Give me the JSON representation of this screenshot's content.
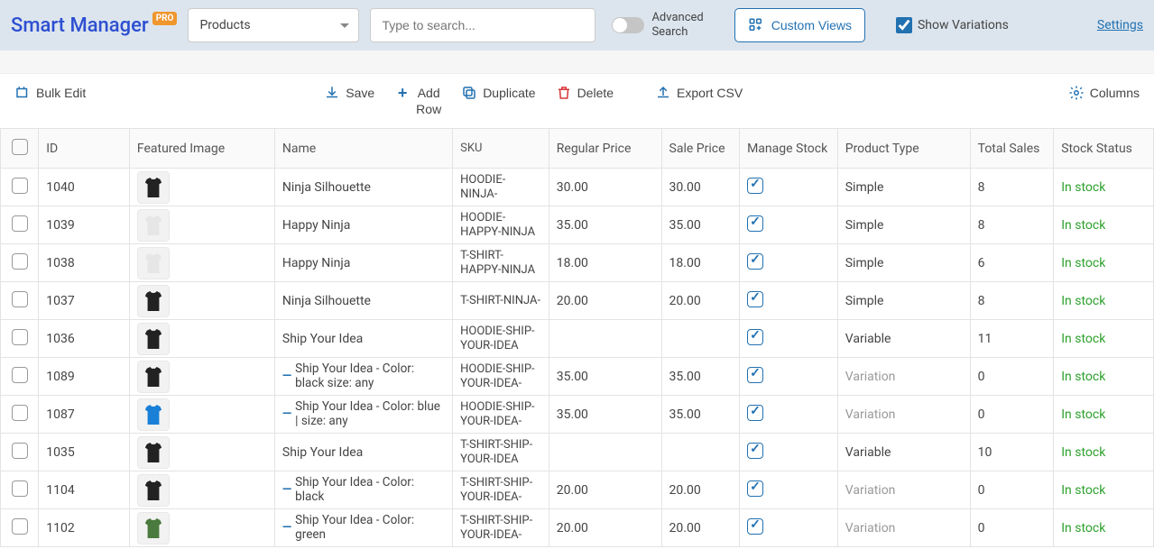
{
  "brand": {
    "name": "Smart Manager",
    "badge": "PRO"
  },
  "header": {
    "dashboard_selected": "Products",
    "search_placeholder": "Type to search...",
    "advanced_search": "Advanced\nSearch",
    "custom_views": "Custom Views",
    "show_variations": "Show Variations",
    "settings": "Settings"
  },
  "actions": {
    "bulk_edit": "Bulk Edit",
    "save": "Save",
    "add_row": "Add Row",
    "duplicate": "Duplicate",
    "delete": "Delete",
    "export_csv": "Export CSV",
    "columns": "Columns"
  },
  "columns": {
    "id": "ID",
    "featured_image": "Featured Image",
    "name": "Name",
    "sku": "SKU",
    "regular_price": "Regular Price",
    "sale_price": "Sale Price",
    "manage_stock": "Manage Stock",
    "product_type": "Product Type",
    "total_sales": "Total Sales",
    "stock_status": "Stock Status"
  },
  "rows": [
    {
      "id": "1040",
      "color": "#222",
      "name": "Ninja Silhouette",
      "variation": false,
      "sku": "HOODIE-NINJA-",
      "reg": "30.00",
      "sale": "30.00",
      "manage": true,
      "type": "Simple",
      "sales": "8",
      "status": "In stock"
    },
    {
      "id": "1039",
      "color": "#e6e6e6",
      "name": "Happy Ninja",
      "variation": false,
      "sku": "HOODIE-HAPPY-NINJA",
      "reg": "35.00",
      "sale": "35.00",
      "manage": true,
      "type": "Simple",
      "sales": "8",
      "status": "In stock"
    },
    {
      "id": "1038",
      "color": "#e6e6e6",
      "name": "Happy Ninja",
      "variation": false,
      "sku": "T-SHIRT-HAPPY-NINJA",
      "reg": "18.00",
      "sale": "18.00",
      "manage": true,
      "type": "Simple",
      "sales": "6",
      "status": "In stock"
    },
    {
      "id": "1037",
      "color": "#222",
      "name": "Ninja Silhouette",
      "variation": false,
      "sku": "T-SHIRT-NINJA-",
      "reg": "20.00",
      "sale": "20.00",
      "manage": true,
      "type": "Simple",
      "sales": "8",
      "status": "In stock"
    },
    {
      "id": "1036",
      "color": "#222",
      "name": "Ship Your Idea",
      "variation": false,
      "sku": "HOODIE-SHIP-YOUR-IDEA",
      "reg": "",
      "sale": "",
      "manage": true,
      "type": "Variable",
      "sales": "11",
      "status": "In stock"
    },
    {
      "id": "1089",
      "color": "#222",
      "name": "Ship Your Idea - Color: black size: any",
      "variation": true,
      "sku": "HOODIE-SHIP-YOUR-IDEA-",
      "reg": "35.00",
      "sale": "35.00",
      "manage": true,
      "type": "Variation",
      "sales": "0",
      "status": "In stock"
    },
    {
      "id": "1087",
      "color": "#1a7fd6",
      "name": "Ship Your Idea - Color: blue | size: any",
      "variation": true,
      "sku": "HOODIE-SHIP-YOUR-IDEA-",
      "reg": "35.00",
      "sale": "35.00",
      "manage": true,
      "type": "Variation",
      "sales": "0",
      "status": "In stock"
    },
    {
      "id": "1035",
      "color": "#222",
      "name": "Ship Your Idea",
      "variation": false,
      "sku": "T-SHIRT-SHIP-YOUR-IDEA",
      "reg": "",
      "sale": "",
      "manage": true,
      "type": "Variable",
      "sales": "10",
      "status": "In stock"
    },
    {
      "id": "1104",
      "color": "#222",
      "name": "Ship Your Idea - Color: black",
      "variation": true,
      "sku": "T-SHIRT-SHIP-YOUR-IDEA-",
      "reg": "20.00",
      "sale": "20.00",
      "manage": true,
      "type": "Variation",
      "sales": "0",
      "status": "In stock"
    },
    {
      "id": "1102",
      "color": "#4a7a3e",
      "name": "Ship Your Idea - Color: green",
      "variation": true,
      "sku": "T-SHIRT-SHIP-YOUR-IDEA-",
      "reg": "20.00",
      "sale": "20.00",
      "manage": true,
      "type": "Variation",
      "sales": "0",
      "status": "In stock"
    }
  ]
}
